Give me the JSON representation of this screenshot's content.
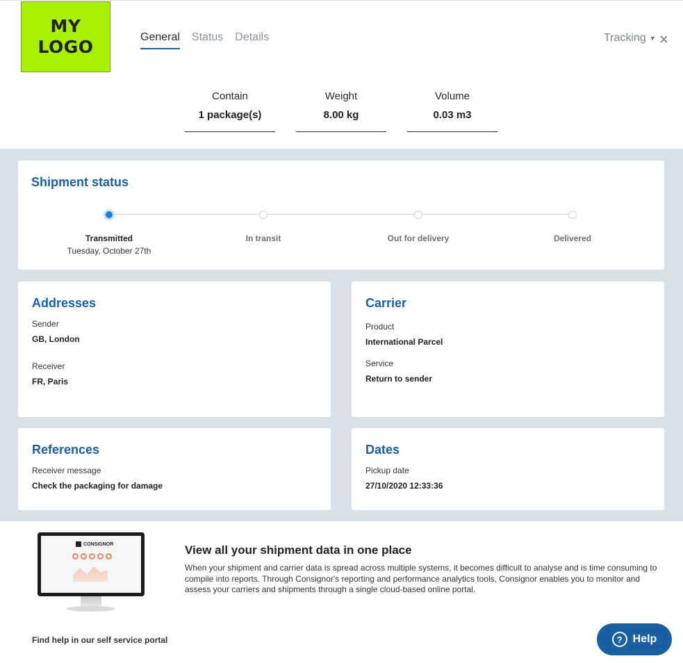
{
  "header": {
    "logo_line1": "MY",
    "logo_line2": "LOGO",
    "tabs": [
      {
        "label": "General",
        "active": true
      },
      {
        "label": "Status",
        "active": false
      },
      {
        "label": "Details",
        "active": false
      }
    ],
    "tracking_label": "Tracking",
    "close_symbol": "×"
  },
  "summary": [
    {
      "label": "Contain",
      "value": "1 package(s)"
    },
    {
      "label": "Weight",
      "value": "8.00 kg"
    },
    {
      "label": "Volume",
      "value": "0.03 m3"
    }
  ],
  "shipment_status": {
    "title": "Shipment status",
    "steps": [
      {
        "label": "Transmitted",
        "date": "Tuesday, October 27th",
        "active": true
      },
      {
        "label": "In transit",
        "date": "",
        "active": false
      },
      {
        "label": "Out for delivery",
        "date": "",
        "active": false
      },
      {
        "label": "Delivered",
        "date": "",
        "active": false
      }
    ]
  },
  "addresses": {
    "title": "Addresses",
    "sender_label": "Sender",
    "sender_value": "GB, London",
    "receiver_label": "Receiver",
    "receiver_value": "FR, Paris"
  },
  "carrier": {
    "title": "Carrier",
    "product_label": "Product",
    "product_value": "International Parcel",
    "service_label": "Service",
    "service_value": "Return to sender"
  },
  "references": {
    "title": "References",
    "message_label": "Receiver message",
    "message_value": "Check the packaging for damage"
  },
  "dates": {
    "title": "Dates",
    "pickup_label": "Pickup date",
    "pickup_value": "27/10/2020 12:33:36"
  },
  "promo": {
    "monitor_brand": "CONSIGNOR",
    "title": "View all your shipment data in one place",
    "text": "When your shipment and carrier data is spread across multiple systems, it becomes difficult to analyse and is time consuming to compile into reports. Through Consignor's reporting and performance analytics tools, Consignor enables you to monitor and assess your carriers and shipments through a single cloud-based online portal."
  },
  "footer": {
    "help_link": "Find help in our self service portal",
    "help_button": "Help",
    "help_symbol": "?"
  },
  "colors": {
    "accent": "#1b5fa3",
    "band": "#d9e1e8",
    "logo": "#a8f000",
    "active_dot": "#1e7fd6"
  }
}
